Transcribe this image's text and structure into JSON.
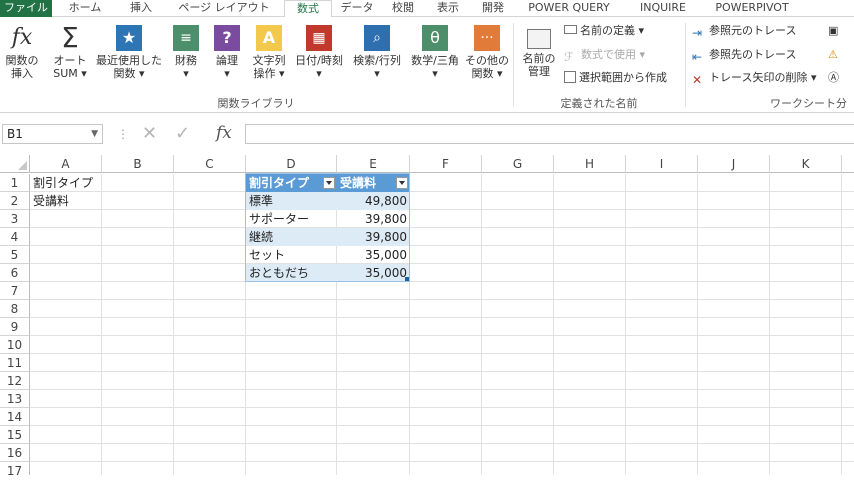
{
  "ribbon_tabs": [
    "ファイル",
    "ホーム",
    "挿入",
    "ページ レイアウト",
    "数式",
    "データ",
    "校閲",
    "表示",
    "開発",
    "POWER QUERY",
    "INQUIRE",
    "POWERPIVOT"
  ],
  "active_tab": "数式",
  "colors": {
    "excel_green": "#217346",
    "table_header": "#5b9bd5",
    "table_band": "#ddebf7"
  },
  "function_library": {
    "insert_function": {
      "line1": "関数の",
      "line2": "挿入"
    },
    "autosum": {
      "line1": "オート",
      "line2": "SUM ▾"
    },
    "recently_used": {
      "line1": "最近使用した",
      "line2": "関数 ▾"
    },
    "financial": {
      "line1": "財務",
      "line2": "▾"
    },
    "logical": {
      "line1": "論理",
      "line2": "▾"
    },
    "text": {
      "line1": "文字列",
      "line2": "操作 ▾"
    },
    "date_time": {
      "line1": "日付/時刻",
      "line2": "▾"
    },
    "lookup": {
      "line1": "検索/行列",
      "line2": "▾"
    },
    "math": {
      "line1": "数学/三角",
      "line2": "▾"
    },
    "more": {
      "line1": "その他の",
      "line2": "関数 ▾"
    },
    "label": "関数ライブラリ"
  },
  "defined_names": {
    "name_manager": {
      "line1": "名前の",
      "line2": "管理"
    },
    "define_name": "名前の定義 ▾",
    "use_in_formula": "数式で使用 ▾",
    "create_from_selection": "選択範囲から作成",
    "label": "定義された名前"
  },
  "formula_auditing": {
    "trace_precedents": "参照元のトレース",
    "trace_dependents": "参照先のトレース",
    "remove_arrows": "トレース矢印の削除 ▾",
    "label": "ワークシート分"
  },
  "formula_bar": {
    "name_box": "B1",
    "formula": ""
  },
  "columns": [
    "A",
    "B",
    "C",
    "D",
    "E",
    "F",
    "G",
    "H",
    "I",
    "J",
    "K"
  ],
  "rows": [
    "1",
    "2",
    "3",
    "4",
    "5",
    "6",
    "7",
    "8",
    "9",
    "10",
    "11",
    "12",
    "13",
    "14",
    "15",
    "16",
    "17"
  ],
  "cells": {
    "A1": "割引タイプ",
    "A2": "受講料"
  },
  "table": {
    "headers": [
      "割引タイプ",
      "受講料"
    ],
    "rows": [
      [
        "標準",
        "49,800"
      ],
      [
        "サポーター",
        "39,800"
      ],
      [
        "継続",
        "39,800"
      ],
      [
        "セット",
        "35,000"
      ],
      [
        "おともだち",
        "35,000"
      ]
    ]
  }
}
